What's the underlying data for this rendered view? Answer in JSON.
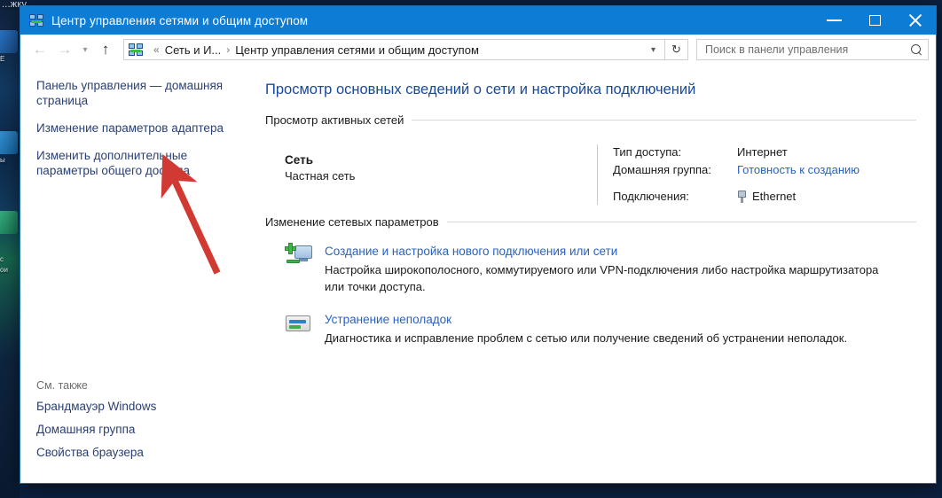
{
  "desktop": {
    "top_text": "...жку",
    "left_labels": [
      "e",
      "E",
      "ы",
      "c",
      "ои"
    ]
  },
  "window": {
    "title": "Центр управления сетями и общим доступом",
    "icon": "network-sharing-icon",
    "controls": {
      "minimize": "minimize-icon",
      "maximize": "maximize-icon",
      "close": "close-icon"
    }
  },
  "navbar": {
    "back": "back-arrow-icon",
    "forward": "forward-arrow-icon",
    "history": "chevron-down-icon",
    "up": "up-arrow-icon",
    "address_icon": "network-sharing-icon",
    "breadcrumb": {
      "prefix": "«",
      "parent": "Сеть и И...",
      "separator": "›",
      "current": "Центр управления сетями и общим доступом"
    },
    "address_chevron": "chevron-down-icon",
    "refresh": "refresh-icon",
    "search": {
      "placeholder": "Поиск в панели управления",
      "value": "",
      "icon": "search-icon"
    }
  },
  "sidebar": {
    "links": [
      "Панель управления — домашняя страница",
      "Изменение параметров адаптера",
      "Изменить дополнительные параметры общего доступа"
    ],
    "see_also_title": "См. также",
    "see_also": [
      "Брандмауэр Windows",
      "Домашняя группа",
      "Свойства браузера"
    ]
  },
  "content": {
    "heading": "Просмотр основных сведений о сети и настройка подключений",
    "active_networks": {
      "section_label": "Просмотр активных сетей",
      "network_name": "Сеть",
      "network_type": "Частная сеть",
      "details": [
        {
          "label": "Тип доступа:",
          "value": "Интернет",
          "is_link": false
        },
        {
          "label": "Домашняя группа:",
          "value": "Готовность к созданию",
          "is_link": true
        },
        {
          "label": "Подключения:",
          "value": "Ethernet",
          "is_link": true,
          "icon": "ethernet-icon"
        }
      ]
    },
    "change_settings": {
      "section_label": "Изменение сетевых параметров",
      "tasks": [
        {
          "icon": "new-connection-icon",
          "link": "Создание и настройка нового подключения или сети",
          "description": "Настройка широкополосного, коммутируемого или VPN-подключения либо настройка маршрутизатора или точки доступа."
        },
        {
          "icon": "troubleshoot-icon",
          "link": "Устранение неполадок",
          "description": "Диагностика и исправление проблем с сетью или получение сведений об устранении неполадок."
        }
      ]
    }
  },
  "annotation": {
    "type": "red-arrow",
    "color": "#d03a32",
    "points_to": "Изменить дополнительные параметры общего доступа"
  },
  "colors": {
    "titlebar": "#0c7cd5",
    "heading": "#17499a",
    "link": "#2a62bd",
    "sidebar_link": "#2a3f73",
    "annotation": "#d03a32"
  }
}
